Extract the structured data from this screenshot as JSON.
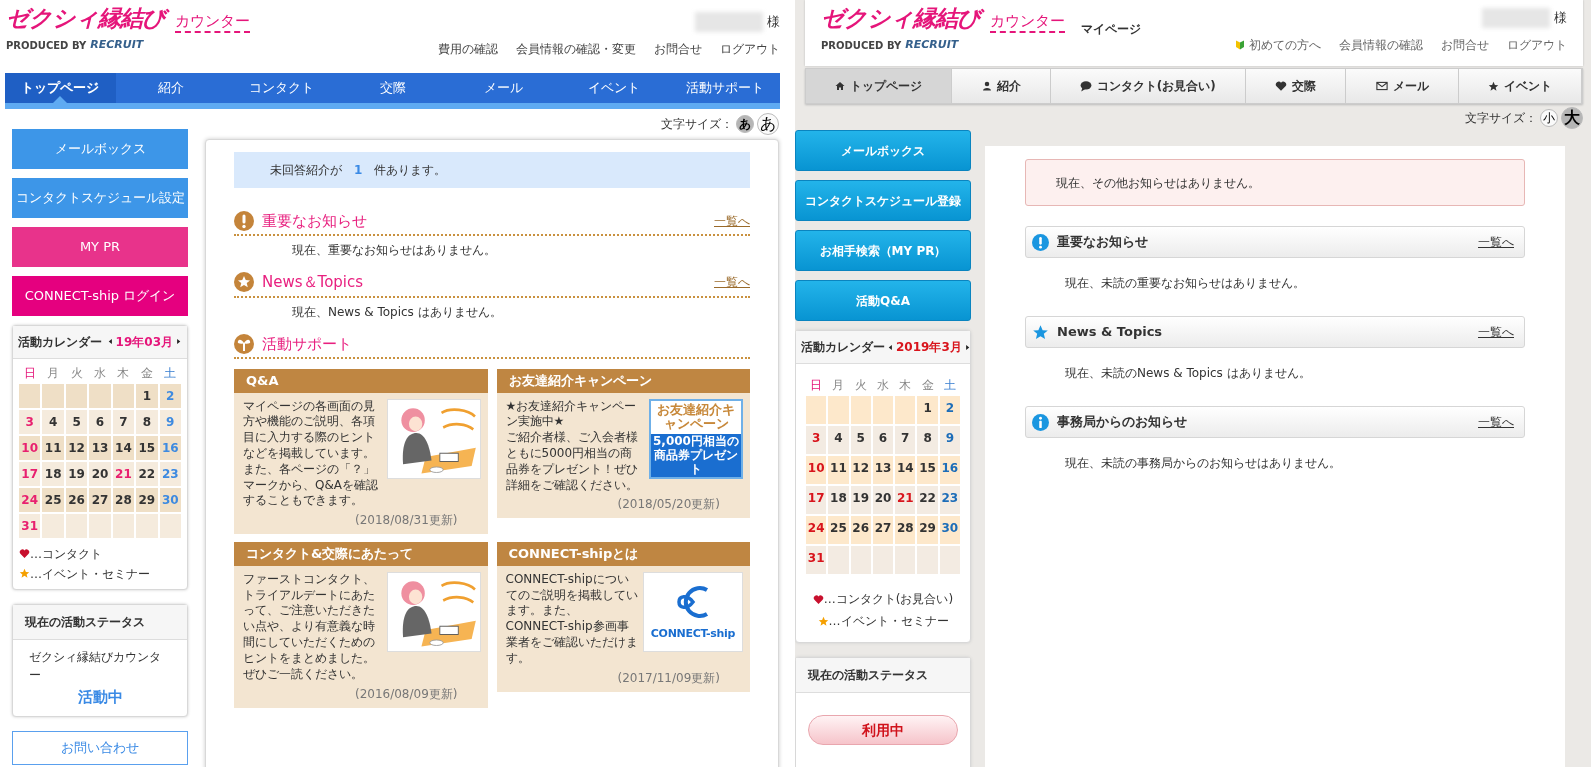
{
  "left": {
    "logo": {
      "name": "ゼクシィ縁結び",
      "sub": "カウンター",
      "produced": "PRODUCED BY",
      "company": "RECRUIT"
    },
    "user_suffix": "様",
    "header_links": [
      "費用の確認",
      "会員情報の確認・変更",
      "お問合せ",
      "ログアウト"
    ],
    "nav": [
      {
        "label": "トップページ",
        "selected": true
      },
      {
        "label": "紹介",
        "selected": false
      },
      {
        "label": "コンタクト",
        "selected": false
      },
      {
        "label": "交際",
        "selected": false
      },
      {
        "label": "メール",
        "selected": false
      },
      {
        "label": "イベント",
        "selected": false
      },
      {
        "label": "活動サポート",
        "selected": false
      }
    ],
    "font_size": {
      "label": "文字サイズ：",
      "options": [
        {
          "label": "あ",
          "selected": true
        },
        {
          "label": "あ",
          "selected": false
        }
      ]
    },
    "side_buttons": [
      {
        "label": "メールボックス",
        "color": "#3d96e8"
      },
      {
        "label": "コンタクトスケジュール設定",
        "color": "#3d96e8"
      },
      {
        "label": "MY PR",
        "color": "#e8338b"
      },
      {
        "label": "CONNECT-ship ログイン",
        "color": "#e5007f"
      }
    ],
    "calendar": {
      "title": "活動カレンダー",
      "month": "19年03月",
      "weekdays": [
        "日",
        "月",
        "火",
        "水",
        "木",
        "金",
        "土"
      ],
      "weeks": [
        [
          {
            "kind": "blank"
          },
          {
            "kind": "blank"
          },
          {
            "kind": "blank"
          },
          {
            "kind": "blank"
          },
          {
            "kind": "blank"
          },
          {
            "kind": "weekday",
            "day": "1"
          },
          {
            "kind": "saturday",
            "day": "2"
          }
        ],
        [
          {
            "kind": "sunday",
            "day": "3"
          },
          {
            "kind": "weekday",
            "day": "4"
          },
          {
            "kind": "weekday",
            "day": "5"
          },
          {
            "kind": "weekday",
            "day": "6"
          },
          {
            "kind": "weekday",
            "day": "7"
          },
          {
            "kind": "weekday",
            "day": "8"
          },
          {
            "kind": "saturday",
            "day": "9"
          }
        ],
        [
          {
            "kind": "sunday",
            "day": "10"
          },
          {
            "kind": "weekday",
            "day": "11"
          },
          {
            "kind": "weekday",
            "day": "12"
          },
          {
            "kind": "weekday",
            "day": "13"
          },
          {
            "kind": "weekday",
            "day": "14"
          },
          {
            "kind": "weekday",
            "day": "15"
          },
          {
            "kind": "saturday",
            "day": "16"
          }
        ],
        [
          {
            "kind": "sunday",
            "day": "17"
          },
          {
            "kind": "weekday",
            "day": "18"
          },
          {
            "kind": "weekday",
            "day": "19"
          },
          {
            "kind": "weekday",
            "day": "20"
          },
          {
            "kind": "holiday",
            "day": "21"
          },
          {
            "kind": "weekday",
            "day": "22"
          },
          {
            "kind": "saturday",
            "day": "23"
          }
        ],
        [
          {
            "kind": "sunday",
            "day": "24"
          },
          {
            "kind": "weekday",
            "day": "25"
          },
          {
            "kind": "weekday",
            "day": "26"
          },
          {
            "kind": "weekday",
            "day": "27"
          },
          {
            "kind": "weekday",
            "day": "28"
          },
          {
            "kind": "weekday",
            "day": "29"
          },
          {
            "kind": "saturday",
            "day": "30"
          }
        ],
        [
          {
            "kind": "sunday",
            "day": "31"
          },
          {
            "kind": "blank"
          },
          {
            "kind": "blank"
          },
          {
            "kind": "blank"
          },
          {
            "kind": "blank"
          },
          {
            "kind": "blank"
          },
          {
            "kind": "blank"
          }
        ]
      ],
      "legend": [
        {
          "kind": "heart",
          "label": "…コンタクト"
        },
        {
          "kind": "star",
          "label": "…イベント・セミナー"
        }
      ]
    },
    "status": {
      "title": "現在の活動ステータス",
      "service": "ゼクシィ縁結びカウンター",
      "value": "活動中"
    },
    "contact_button": "お問い合わせ",
    "notice": {
      "before": "未回答紹介が",
      "count": "1",
      "after": "件あります。"
    },
    "sections": [
      {
        "kind": "important",
        "title": "重要なお知らせ",
        "more": "一覧へ",
        "message": "現在、重要なお知らせはありません。"
      },
      {
        "kind": "news",
        "title": "News＆Topics",
        "more": "一覧へ",
        "message": "現在、News & Topics はありません。"
      },
      {
        "kind": "support",
        "title": "活動サポート",
        "cards": [
          {
            "title": "Q&A",
            "text": "マイページの各画面の見方や機能のご説明、各項目に入力する際のヒントなどを掲載しています。また、各ページの「？」マークから、Q&Aを確認することもできます。",
            "date": "(2018/08/31更新)"
          },
          {
            "title": "お友達紹介キャンペーン",
            "text": "★お友達紹介キャンペーン実施中★\nご紹介者様、ご入会者様ともに5000円相当の商品券をプレゼント！ぜひ詳細をご確認ください。",
            "date": "(2018/05/20更新)",
            "image": {
              "kind": "banner",
              "title": "お友達紹介キャンペーン",
              "caption": "5,000円相当の商品券プレゼント"
            }
          },
          {
            "title": "コンタクト&交際にあたって",
            "text": "ファーストコンタクト、トライアルデートにあたって、ご注意いただきたい点や、より有意義な時間にしていただくためのヒントをまとめました。ぜひご一読ください。",
            "date": "(2016/08/09更新)"
          },
          {
            "title": "CONNECT-shipとは",
            "text": "CONNECT-shipについてのご説明を掲載しています。また、CONNECT-ship参画事業者をご確認いただけます。",
            "date": "(2017/11/09更新)",
            "image": {
              "kind": "logo",
              "text": "CONNECT-ship"
            }
          }
        ]
      }
    ]
  },
  "right": {
    "logo": {
      "name": "ゼクシィ縁結び",
      "sub": "カウンター",
      "produced": "PRODUCED BY",
      "company": "RECRUIT"
    },
    "page_title": "マイページ",
    "user_suffix": "様",
    "header_links": [
      {
        "label": "初めての方へ",
        "kind": "beginner"
      },
      {
        "label": "会員情報の確認",
        "kind": "plain"
      },
      {
        "label": "お問合せ",
        "kind": "plain"
      },
      {
        "label": "ログアウト",
        "kind": "plain"
      }
    ],
    "nav": [
      {
        "label": "トップページ",
        "selected": true
      },
      {
        "label": "紹介",
        "selected": false
      },
      {
        "label": "コンタクト(お見合い)",
        "selected": false
      },
      {
        "label": "交際",
        "selected": false
      },
      {
        "label": "メール",
        "selected": false
      },
      {
        "label": "イベント",
        "selected": false
      }
    ],
    "font_size": {
      "label": "文字サイズ：",
      "options": [
        {
          "label": "小",
          "selected": false
        },
        {
          "label": "大",
          "selected": true
        }
      ]
    },
    "side_buttons": [
      "メールボックス",
      "コンタクトスケジュール登録",
      "お相手検索（MY PR）",
      "活動Q&A"
    ],
    "calendar": {
      "title": "活動カレンダー",
      "month": "2019年3月",
      "weekdays": [
        "日",
        "月",
        "火",
        "水",
        "木",
        "金",
        "土"
      ],
      "weeks": [
        [
          {
            "kind": "blank"
          },
          {
            "kind": "blank"
          },
          {
            "kind": "blank"
          },
          {
            "kind": "blank"
          },
          {
            "kind": "blank"
          },
          {
            "kind": "weekday",
            "day": "1"
          },
          {
            "kind": "saturday",
            "day": "2"
          }
        ],
        [
          {
            "kind": "sunday",
            "day": "3"
          },
          {
            "kind": "weekday",
            "day": "4"
          },
          {
            "kind": "weekday",
            "day": "5"
          },
          {
            "kind": "weekday",
            "day": "6"
          },
          {
            "kind": "weekday",
            "day": "7"
          },
          {
            "kind": "weekday",
            "day": "8"
          },
          {
            "kind": "saturday",
            "day": "9"
          }
        ],
        [
          {
            "kind": "sunday",
            "day": "10"
          },
          {
            "kind": "weekday",
            "day": "11"
          },
          {
            "kind": "weekday",
            "day": "12"
          },
          {
            "kind": "weekday",
            "day": "13"
          },
          {
            "kind": "weekday",
            "day": "14"
          },
          {
            "kind": "weekday",
            "day": "15"
          },
          {
            "kind": "saturday",
            "day": "16"
          }
        ],
        [
          {
            "kind": "sunday",
            "day": "17"
          },
          {
            "kind": "weekday",
            "day": "18"
          },
          {
            "kind": "weekday",
            "day": "19"
          },
          {
            "kind": "weekday",
            "day": "20"
          },
          {
            "kind": "holiday",
            "day": "21"
          },
          {
            "kind": "weekday",
            "day": "22"
          },
          {
            "kind": "saturday",
            "day": "23"
          }
        ],
        [
          {
            "kind": "sunday",
            "day": "24"
          },
          {
            "kind": "weekday",
            "day": "25"
          },
          {
            "kind": "weekday",
            "day": "26"
          },
          {
            "kind": "weekday",
            "day": "27"
          },
          {
            "kind": "weekday",
            "day": "28"
          },
          {
            "kind": "weekday",
            "day": "29"
          },
          {
            "kind": "saturday",
            "day": "30"
          }
        ],
        [
          {
            "kind": "sunday",
            "day": "31"
          },
          {
            "kind": "blank"
          },
          {
            "kind": "blank"
          },
          {
            "kind": "blank"
          },
          {
            "kind": "blank"
          },
          {
            "kind": "blank"
          },
          {
            "kind": "blank"
          }
        ]
      ],
      "legend": [
        {
          "kind": "heart",
          "label": "…コンタクト(お見合い)"
        },
        {
          "kind": "star",
          "label": "…イベント・セミナー"
        }
      ]
    },
    "status": {
      "title": "現在の活動ステータス",
      "value": "利用中"
    },
    "alert": "現在、その他お知らせはありません。",
    "sections": [
      {
        "kind": "important",
        "title": "重要なお知らせ",
        "more": "一覧へ",
        "message": "現在、未読の重要なお知らせはありません。"
      },
      {
        "kind": "news",
        "title": "News & Topics",
        "more": "一覧へ",
        "message": "現在、未読のNews & Topics はありません。"
      },
      {
        "kind": "office",
        "title": "事務局からのお知らせ",
        "more": "一覧へ",
        "message": "現在、未読の事務局からのお知らせはありません。"
      }
    ]
  }
}
